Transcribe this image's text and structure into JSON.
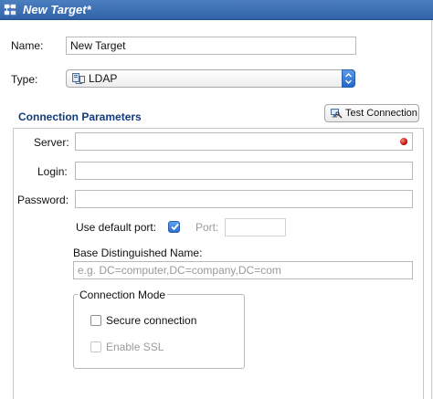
{
  "window": {
    "title": "New Target*",
    "title_icon": "target-list-icon"
  },
  "form": {
    "name_label": "Name:",
    "name_value": "New Target",
    "type_label": "Type:",
    "type_value": "LDAP",
    "type_icon": "ldap-server-icon"
  },
  "connection": {
    "section_title": "Connection Parameters",
    "test_button_label": "Test Connection",
    "test_button_icon": "test-connection-icon",
    "server_label": "Server:",
    "server_value": "",
    "server_status_color": "#c00000",
    "login_label": "Login:",
    "login_value": "",
    "password_label": "Password:",
    "password_value": "",
    "use_default_port_label": "Use default port:",
    "use_default_port_checked": true,
    "port_label": "Port:",
    "port_value": "",
    "base_dn_label": "Base Distinguished Name:",
    "base_dn_value": "",
    "base_dn_placeholder": "e.g. DC=computer,DC=company,DC=com"
  },
  "connection_mode": {
    "title": "Connection Mode",
    "secure_label": "Secure connection",
    "secure_checked": false,
    "ssl_label": "Enable SSL",
    "ssl_checked": false,
    "ssl_enabled": false
  },
  "colors": {
    "titlebar": "#3a6db5",
    "section_title": "#123c7a",
    "accent": "#2c6fd1"
  }
}
